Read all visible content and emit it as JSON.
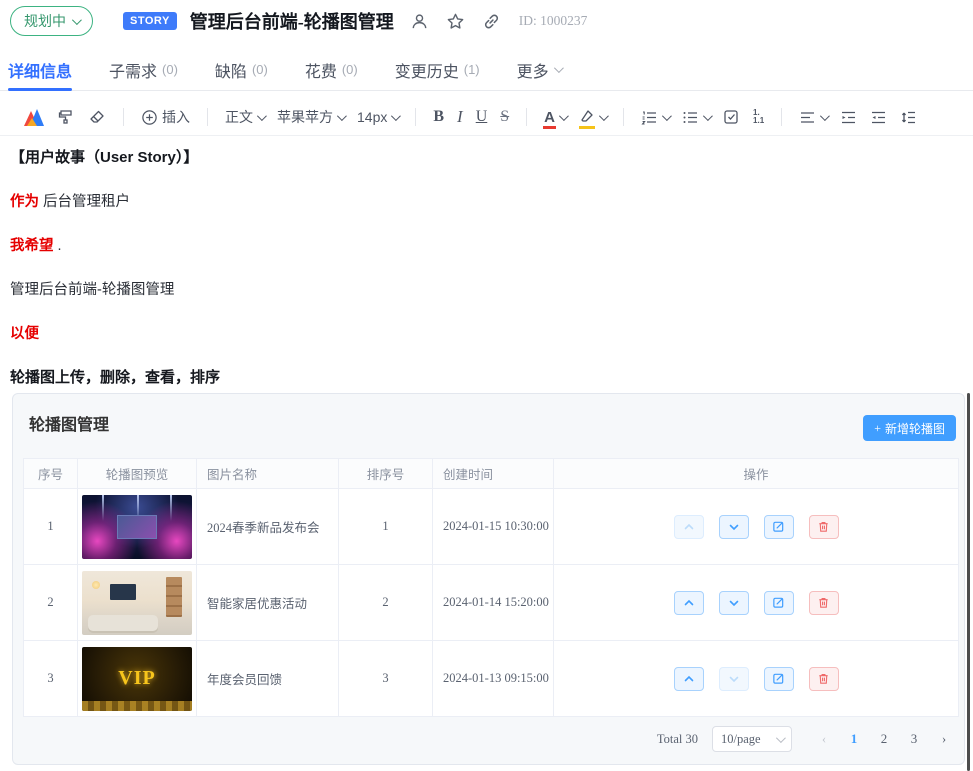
{
  "header": {
    "status": "规划中",
    "badge": "STORY",
    "title": "管理后台前端-轮播图管理",
    "id_label": "ID: 1000237"
  },
  "tabs": [
    {
      "label": "详细信息",
      "count": ""
    },
    {
      "label": "子需求",
      "count": "(0)"
    },
    {
      "label": "缺陷",
      "count": "(0)"
    },
    {
      "label": "花费",
      "count": "(0)"
    },
    {
      "label": "变更历史",
      "count": "(1)"
    },
    {
      "label": "更多",
      "count": ""
    }
  ],
  "toolbar": {
    "insert_label": "插入",
    "paragraph_select": "正文",
    "font_select": "苹果苹方",
    "size_select": "14px",
    "bold": "B",
    "italic": "I",
    "underline": "U",
    "strike": "S",
    "font_color_letter": "A",
    "multilevel_label_top": "1.",
    "multilevel_label_bottom": "1.1"
  },
  "story": {
    "heading": "【用户故事（User Story）】",
    "as_a": "作为",
    "as_a_value": "后台管理租户",
    "i_want": "我希望",
    "i_want_value": ".",
    "feature_line": "管理后台前端-轮播图管理",
    "so_that": "以便",
    "benefit_line": "轮播图上传，删除，查看，排序"
  },
  "panel": {
    "title": "轮播图管理",
    "add_button": {
      "plus": "+",
      "label": "新增轮播图"
    },
    "table": {
      "headers": [
        "序号",
        "轮播图预览",
        "图片名称",
        "排序号",
        "创建时间",
        "操作"
      ],
      "rows": [
        {
          "index": "1",
          "thumb": "concert-stage",
          "name": "2024春季新品发布会",
          "sort": "1",
          "created": "2024-01-15 10:30:00"
        },
        {
          "index": "2",
          "thumb": "smart-home-living-room",
          "name": "智能家居优惠活动",
          "sort": "2",
          "created": "2024-01-14 15:20:00"
        },
        {
          "index": "3",
          "thumb": "vip-gold",
          "thumb_label": "VIP",
          "name": "年度会员回馈",
          "sort": "3",
          "created": "2024-01-13 09:15:00"
        }
      ]
    },
    "footer": {
      "total": "Total 30",
      "page_size": "10/page",
      "prev": "‹",
      "pages": [
        "1",
        "2",
        "3"
      ],
      "next": "›",
      "current_page": "1"
    }
  },
  "colors": {
    "status_green": "#3db382",
    "badge_blue": "#3e7bfa",
    "tab_active_blue": "#3370ff",
    "panel_accent_blue": "#409eff",
    "danger_red": "#f56c6c",
    "story_red": "#e50000"
  }
}
